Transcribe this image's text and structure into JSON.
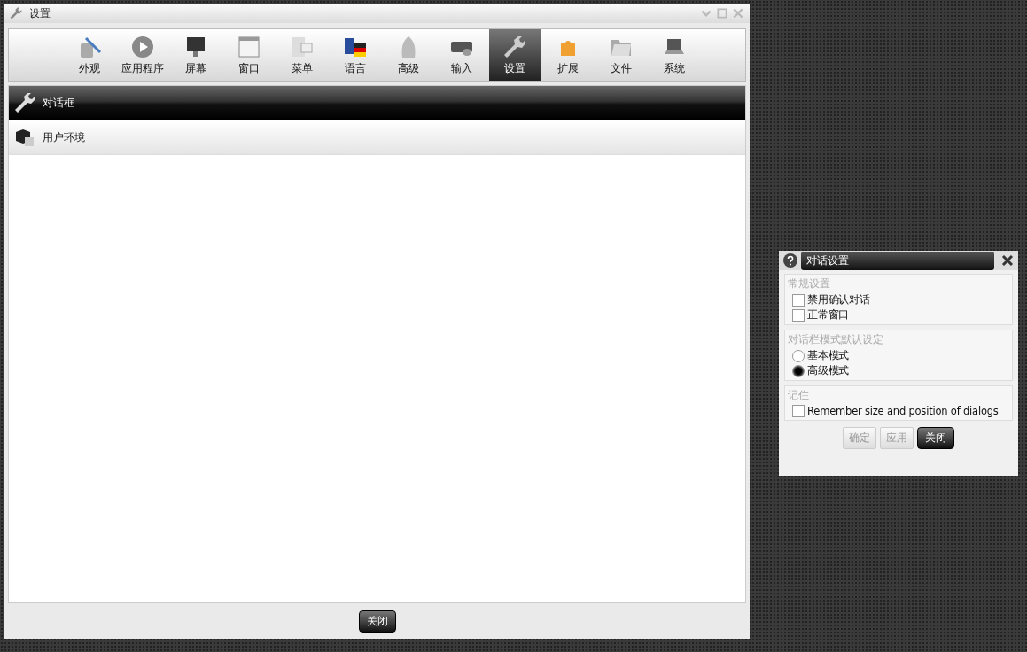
{
  "window": {
    "title": "设置"
  },
  "toolbar": [
    {
      "label": "外观",
      "selected": false
    },
    {
      "label": "应用程序",
      "selected": false
    },
    {
      "label": "屏幕",
      "selected": false
    },
    {
      "label": "窗口",
      "selected": false
    },
    {
      "label": "菜单",
      "selected": false
    },
    {
      "label": "语言",
      "selected": false
    },
    {
      "label": "高级",
      "selected": false
    },
    {
      "label": "输入",
      "selected": false
    },
    {
      "label": "设置",
      "selected": true
    },
    {
      "label": "扩展",
      "selected": false
    },
    {
      "label": "文件",
      "selected": false
    },
    {
      "label": "系统",
      "selected": false
    }
  ],
  "sections": [
    {
      "label": "对话框",
      "selected": true
    },
    {
      "label": "用户环境",
      "selected": false
    }
  ],
  "footer_button": "关闭",
  "dialog": {
    "title": "对话设置",
    "groups": [
      {
        "title": "常规设置",
        "options": [
          {
            "kind": "checkbox",
            "label": "禁用确认对话",
            "checked": false
          },
          {
            "kind": "checkbox",
            "label": "正常窗口",
            "checked": false
          }
        ]
      },
      {
        "title": "对话栏模式默认设定",
        "options": [
          {
            "kind": "radio",
            "label": "基本模式",
            "selected": false
          },
          {
            "kind": "radio",
            "label": "高级模式",
            "selected": true
          }
        ]
      },
      {
        "title": "记住",
        "options": [
          {
            "kind": "checkbox",
            "label": "Remember size and position of dialogs",
            "checked": false
          }
        ]
      }
    ],
    "buttons": [
      {
        "label": "确定",
        "disabled": true
      },
      {
        "label": "应用",
        "disabled": true
      },
      {
        "label": "关闭",
        "disabled": false
      }
    ]
  }
}
